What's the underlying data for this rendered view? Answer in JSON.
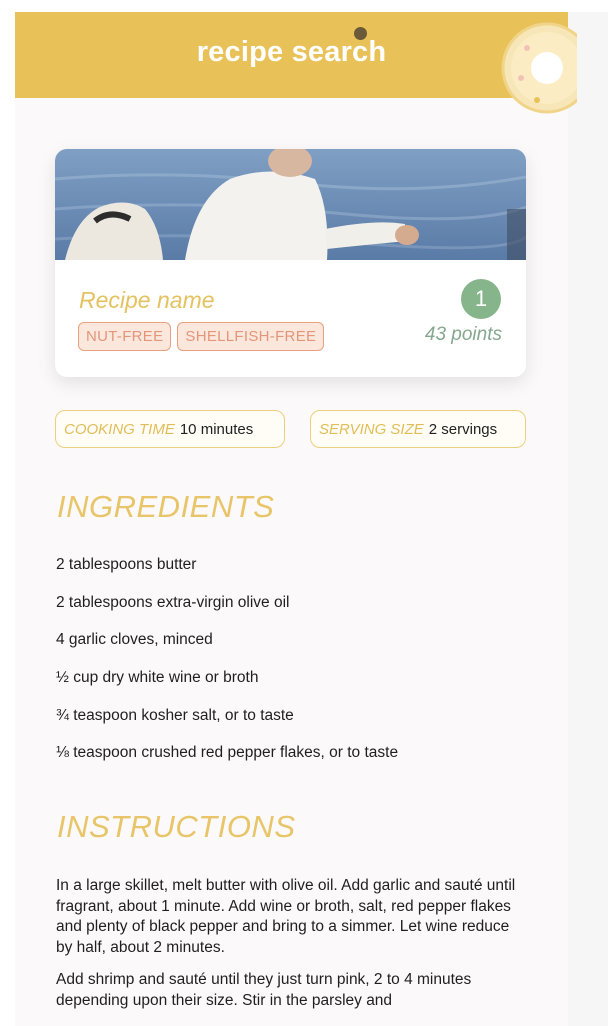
{
  "header": {
    "title": "recipe search"
  },
  "recipe": {
    "name": "Recipe name",
    "rank": "1",
    "points": "43 points",
    "tags": [
      "NUT-FREE",
      "SHELLFISH-FREE"
    ],
    "image_description": "photo"
  },
  "details": {
    "cooking_time_label": "COOKING TIME",
    "cooking_time_value": "10 minutes",
    "serving_size_label": "SERVING SIZE",
    "serving_size_value": "2 servings"
  },
  "ingredients": {
    "heading": "INGREDIENTS",
    "items": [
      "2 tablespoons butter",
      "2 tablespoons extra-virgin olive oil",
      "4 garlic cloves, minced",
      "½ cup dry white wine or broth",
      "¾ teaspoon kosher salt, or to taste",
      "⅛ teaspoon crushed red pepper flakes, or to taste"
    ]
  },
  "instructions": {
    "heading": "INSTRUCTIONS",
    "steps": [
      "In a large skillet, melt butter with olive oil. Add garlic and sauté until fragrant, about 1 minute. Add wine or broth, salt, red pepper flakes and plenty of black pepper and bring to a simmer. Let wine reduce by half, about 2 minutes.",
      "Add shrimp and sauté until they just turn pink, 2 to 4 minutes depending upon their size. Stir in the parsley and"
    ]
  },
  "colors": {
    "accent_yellow": "#e8c258",
    "rank_green": "#86b58b",
    "tag_peach": "#e9a07f"
  },
  "icons": [
    "donut-icon"
  ]
}
